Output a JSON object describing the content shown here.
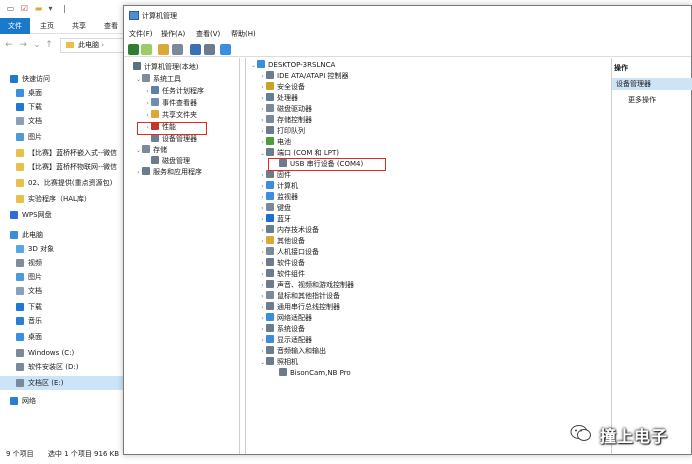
{
  "explorer": {
    "ribbon_tabs": [
      "文件",
      "主页",
      "共享",
      "查看"
    ],
    "breadcrumb": "此电脑",
    "nav_items": [
      {
        "label": "快速访问",
        "icon": "star-icon",
        "color": "#1f78d1"
      },
      {
        "label": "桌面",
        "icon": "desktop-icon",
        "color": "#3a8ee6"
      },
      {
        "label": "下载",
        "icon": "download-icon",
        "color": "#1f78d1"
      },
      {
        "label": "文档",
        "icon": "document-icon",
        "color": "#8aa0b8"
      },
      {
        "label": "图片",
        "icon": "picture-icon",
        "color": "#4b9ad9"
      },
      {
        "label": "【比赛】蓝桥杯嵌入式--微信",
        "icon": "folder-icon",
        "color": "#e8c04b"
      },
      {
        "label": "【比赛】蓝桥杯物联网--微信",
        "icon": "folder-icon",
        "color": "#e8c04b"
      },
      {
        "label": "02、比赛提供(重点资源包)",
        "icon": "folder-icon",
        "color": "#e8c04b"
      },
      {
        "label": "实验程序（HAL库）",
        "icon": "folder-icon",
        "color": "#e8c04b"
      },
      {
        "label": "WPS网盘",
        "icon": "cloud-icon",
        "color": "#2d6fd6"
      },
      {
        "label": "此电脑",
        "icon": "computer-icon",
        "color": "#3b8de0"
      },
      {
        "label": "3D 对象",
        "icon": "cube-icon",
        "color": "#5aa5e8"
      },
      {
        "label": "视频",
        "icon": "video-icon",
        "color": "#7f8c9b"
      },
      {
        "label": "图片",
        "icon": "picture-icon",
        "color": "#4b9ad9"
      },
      {
        "label": "文档",
        "icon": "document-icon",
        "color": "#8aa0b8"
      },
      {
        "label": "下载",
        "icon": "download-icon",
        "color": "#1f78d1"
      },
      {
        "label": "音乐",
        "icon": "music-icon",
        "color": "#2a7fd4"
      },
      {
        "label": "桌面",
        "icon": "desktop-icon",
        "color": "#3a8ee6"
      },
      {
        "label": "Windows (C:)",
        "icon": "drive-icon",
        "color": "#7a8a9a"
      },
      {
        "label": "软件安装区 (D:)",
        "icon": "drive-icon",
        "color": "#7a8a9a"
      },
      {
        "label": "文档区 (E:)",
        "icon": "drive-icon",
        "color": "#7a8a9a"
      },
      {
        "label": "网络",
        "icon": "network-icon",
        "color": "#2a7fd4"
      }
    ],
    "selected_nav": 20,
    "status": {
      "count": "9 个项目",
      "selected": "选中 1 个项目  916 KB"
    }
  },
  "mmc": {
    "title": "计算机管理",
    "menu": [
      "文件(F)",
      "操作(A)",
      "查看(V)",
      "帮助(H)"
    ],
    "tree": [
      {
        "label": "计算机管理(本地)",
        "level": 0,
        "expander": "",
        "icon": "computer-management-icon",
        "color": "#5b6f86"
      },
      {
        "label": "系统工具",
        "level": 1,
        "expander": "v",
        "icon": "tools-icon",
        "color": "#7f8c9b"
      },
      {
        "label": "任务计划程序",
        "level": 2,
        "expander": ">",
        "icon": "clock-icon",
        "color": "#5d7fa8"
      },
      {
        "label": "事件查看器",
        "level": 2,
        "expander": ">",
        "icon": "event-viewer-icon",
        "color": "#6b8fb3"
      },
      {
        "label": "共享文件夹",
        "level": 2,
        "expander": ">",
        "icon": "shared-folder-icon",
        "color": "#d9a93a"
      },
      {
        "label": "性能",
        "level": 2,
        "expander": ">",
        "icon": "performance-icon",
        "color": "#c0392b"
      },
      {
        "label": "设备管理器",
        "level": 2,
        "expander": "",
        "icon": "device-manager-icon",
        "color": "#6d7f94"
      },
      {
        "label": "存储",
        "level": 1,
        "expander": "v",
        "icon": "storage-icon",
        "color": "#7a8a9a"
      },
      {
        "label": "磁盘管理",
        "level": 2,
        "expander": "",
        "icon": "disk-icon",
        "color": "#6b7c8d"
      },
      {
        "label": "服务和应用程序",
        "level": 1,
        "expander": ">",
        "icon": "services-icon",
        "color": "#6b7c8d"
      }
    ],
    "device_root": "DESKTOP-3RSLNCA",
    "devices": [
      {
        "label": "IDE ATA/ATAPI 控制器",
        "level": 1,
        "expander": ">",
        "icon": "ide-icon",
        "color": "#6b7c8d"
      },
      {
        "label": "安全设备",
        "level": 1,
        "expander": ">",
        "icon": "security-device-icon",
        "color": "#c9a227"
      },
      {
        "label": "处理器",
        "level": 1,
        "expander": ">",
        "icon": "processor-icon",
        "color": "#5f7f9a"
      },
      {
        "label": "磁盘驱动器",
        "level": 1,
        "expander": ">",
        "icon": "disk-drive-icon",
        "color": "#7a8a9a"
      },
      {
        "label": "存储控制器",
        "level": 1,
        "expander": ">",
        "icon": "storage-controller-icon",
        "color": "#7a8a9a"
      },
      {
        "label": "打印队列",
        "level": 1,
        "expander": ">",
        "icon": "printer-icon",
        "color": "#6b7c8d"
      },
      {
        "label": "电池",
        "level": 1,
        "expander": ">",
        "icon": "battery-icon",
        "color": "#4f9d3a"
      },
      {
        "label": "端口 (COM 和 LPT)",
        "level": 1,
        "expander": "v",
        "icon": "port-icon",
        "color": "#6b7c8d"
      },
      {
        "label": "USB 串行设备 (COM4)",
        "level": 2,
        "expander": "",
        "icon": "usb-serial-icon",
        "color": "#6b7c8d"
      },
      {
        "label": "固件",
        "level": 1,
        "expander": ">",
        "icon": "firmware-icon",
        "color": "#6b7c8d"
      },
      {
        "label": "计算机",
        "level": 1,
        "expander": ">",
        "icon": "computer-icon",
        "color": "#3b8de0"
      },
      {
        "label": "监视器",
        "level": 1,
        "expander": ">",
        "icon": "monitor-icon",
        "color": "#3b8de0"
      },
      {
        "label": "键盘",
        "level": 1,
        "expander": ">",
        "icon": "keyboard-icon",
        "color": "#7a8a9a"
      },
      {
        "label": "蓝牙",
        "level": 1,
        "expander": ">",
        "icon": "bluetooth-icon",
        "color": "#1f6fd1"
      },
      {
        "label": "内存技术设备",
        "level": 1,
        "expander": ">",
        "icon": "memory-icon",
        "color": "#6b7c8d"
      },
      {
        "label": "其他设备",
        "level": 1,
        "expander": ">",
        "icon": "other-device-icon",
        "color": "#d9a93a"
      },
      {
        "label": "人机接口设备",
        "level": 1,
        "expander": ">",
        "icon": "hid-icon",
        "color": "#7a8a9a"
      },
      {
        "label": "软件设备",
        "level": 1,
        "expander": ">",
        "icon": "software-device-icon",
        "color": "#6b7c8d"
      },
      {
        "label": "软件组件",
        "level": 1,
        "expander": ">",
        "icon": "software-component-icon",
        "color": "#6b7c8d"
      },
      {
        "label": "声音、视频和游戏控制器",
        "level": 1,
        "expander": ">",
        "icon": "sound-icon",
        "color": "#6b7c8d"
      },
      {
        "label": "鼠标和其他指针设备",
        "level": 1,
        "expander": ">",
        "icon": "mouse-icon",
        "color": "#7a8a9a"
      },
      {
        "label": "通用串行总线控制器",
        "level": 1,
        "expander": ">",
        "icon": "usb-controller-icon",
        "color": "#6b7c8d"
      },
      {
        "label": "网络适配器",
        "level": 1,
        "expander": ">",
        "icon": "network-adapter-icon",
        "color": "#3b8de0"
      },
      {
        "label": "系统设备",
        "level": 1,
        "expander": ">",
        "icon": "system-device-icon",
        "color": "#6b7c8d"
      },
      {
        "label": "显示适配器",
        "level": 1,
        "expander": ">",
        "icon": "display-adapter-icon",
        "color": "#3b8de0"
      },
      {
        "label": "音频输入和输出",
        "level": 1,
        "expander": ">",
        "icon": "audio-icon",
        "color": "#6b7c8d"
      },
      {
        "label": "照相机",
        "level": 1,
        "expander": "v",
        "icon": "camera-icon",
        "color": "#6b7c8d"
      },
      {
        "label": "BisonCam,NB Pro",
        "level": 2,
        "expander": "",
        "icon": "webcam-icon",
        "color": "#6b7c8d"
      }
    ],
    "actions": {
      "header": "操作",
      "selected": "设备管理器",
      "more": "更多操作"
    },
    "highlight_color": "#e02b20"
  },
  "watermark": {
    "text": "撞上电子"
  }
}
